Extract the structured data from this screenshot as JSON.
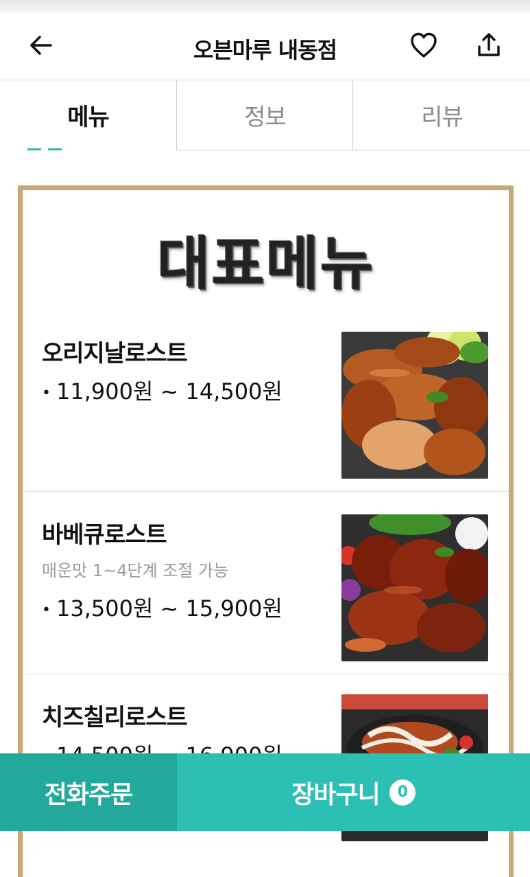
{
  "header": {
    "title": "오븐마루 내동점",
    "back_icon": "arrow-left-icon",
    "favorite_icon": "heart-outline-icon",
    "share_icon": "share-upload-icon"
  },
  "tabs": [
    {
      "label": "메뉴",
      "active": true
    },
    {
      "label": "정보",
      "active": false
    },
    {
      "label": "리뷰",
      "active": false
    }
  ],
  "menu_section": {
    "banner": "대표메뉴",
    "items": [
      {
        "name": "오리지날로스트",
        "desc": "",
        "price": "11,900원 ~ 14,500원"
      },
      {
        "name": "바베큐로스트",
        "desc": "매운맛 1~4단계 조절 가능",
        "price": "13,500원 ~ 15,900원"
      },
      {
        "name": "치즈칠리로스트",
        "desc": "",
        "price": "14,500원 ~ 16,900원"
      }
    ]
  },
  "bottom_bar": {
    "call_label": "전화주문",
    "cart_label": "장바구니",
    "cart_count": "0"
  },
  "colors": {
    "accent": "#2bc0b3",
    "accent_dark": "#22a99c",
    "frame_border": "#c8a878"
  }
}
